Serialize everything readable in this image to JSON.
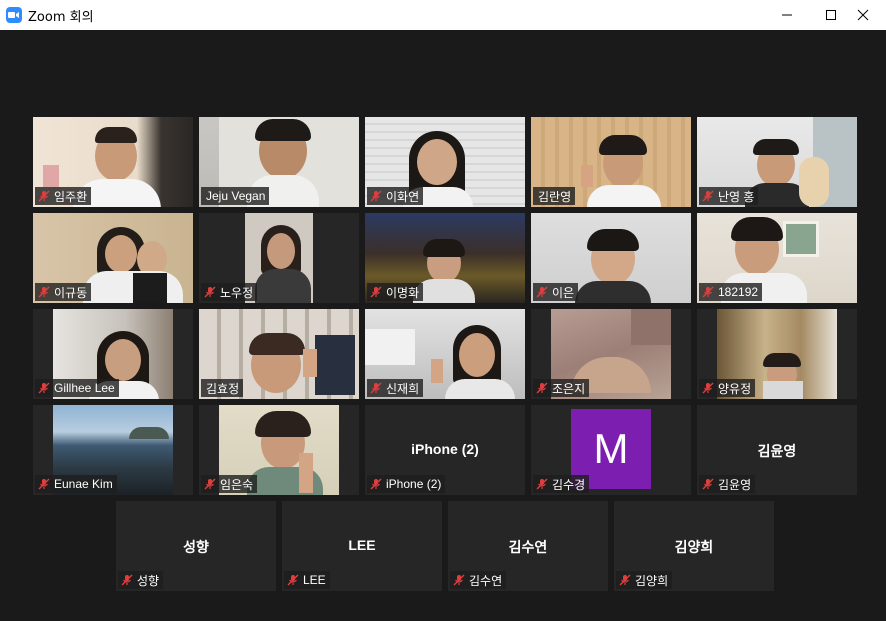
{
  "window": {
    "title": "Zoom 회의",
    "minimize_icon": "minimize-icon",
    "maximize_icon": "maximize-icon",
    "close_icon": "close-icon"
  },
  "colors": {
    "background": "#1a1a1a",
    "tile": "#262626",
    "active_border": "#b7d944",
    "muted_mic": "#e03e3e",
    "zoom_blue": "#2D8CFF",
    "avatar_purple": "#7c1fb0"
  },
  "participants": [
    {
      "name": "임주환",
      "muted": true
    },
    {
      "name": "Jeju Vegan",
      "muted": false
    },
    {
      "name": "이화연",
      "muted": true
    },
    {
      "name": "김란영",
      "muted": false,
      "active_speaker": true
    },
    {
      "name": "난영 홍",
      "muted": true
    },
    {
      "name": "이규동",
      "muted": true
    },
    {
      "name": "노우정",
      "muted": true
    },
    {
      "name": "이명화",
      "muted": true
    },
    {
      "name": "이은",
      "muted": true
    },
    {
      "name": "182192",
      "muted": true
    },
    {
      "name": "Gillhee Lee",
      "muted": true
    },
    {
      "name": "김효정",
      "muted": false
    },
    {
      "name": "신재희",
      "muted": true
    },
    {
      "name": "조은지",
      "muted": true
    },
    {
      "name": "양유정",
      "muted": true
    },
    {
      "name": "Eunae Kim",
      "muted": true
    },
    {
      "name": "임은숙",
      "muted": true
    },
    {
      "name": "iPhone (2)",
      "muted": true,
      "center_name": "iPhone (2)"
    },
    {
      "name": "김수경",
      "muted": true,
      "avatar_letter": "M"
    },
    {
      "name": "김윤영",
      "muted": true,
      "center_name": "김윤영"
    },
    {
      "name": "성향",
      "muted": true,
      "center_name": "성향"
    },
    {
      "name": "LEE",
      "muted": true,
      "center_name": "LEE"
    },
    {
      "name": "김수연",
      "muted": true,
      "center_name": "김수연"
    },
    {
      "name": "김양희",
      "muted": true,
      "center_name": "김양희"
    }
  ]
}
